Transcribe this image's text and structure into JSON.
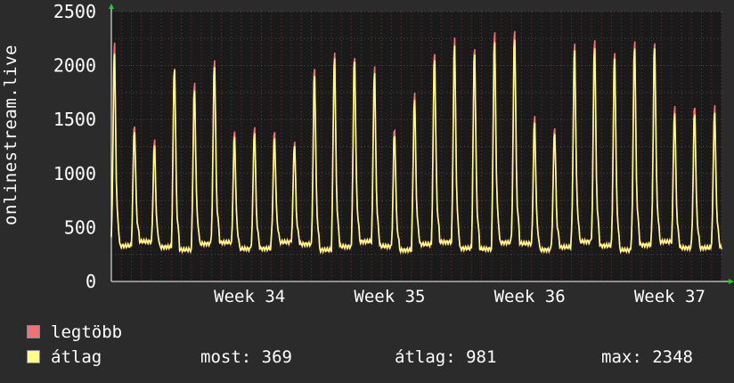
{
  "chart_data": {
    "type": "line",
    "ylabel": "onlinestream.live",
    "ylim": [
      0,
      2500
    ],
    "yticks": [
      0,
      500,
      1000,
      1500,
      2000,
      2500
    ],
    "xticks": [
      {
        "label": "Week 34",
        "day": 7
      },
      {
        "label": "Week 35",
        "day": 14
      },
      {
        "label": "Week 36",
        "day": 21
      },
      {
        "label": "Week 37",
        "day": 28
      }
    ],
    "x_range_days": [
      0,
      30.5
    ],
    "grid": true,
    "series": [
      {
        "name": "legtöbb",
        "color": "#f07178",
        "daily_peak": [
          2260,
          1500,
          1330,
          2060,
          1880,
          2130,
          1420,
          1480,
          1420,
          1330,
          2040,
          2180,
          2150,
          2040,
          1460,
          1780,
          2200,
          2310,
          2250,
          2360,
          2420,
          1560,
          1480,
          2260,
          2320,
          2180,
          2300,
          2280,
          1670
        ]
      },
      {
        "name": "átlag",
        "color": "#ffff80",
        "daily_peak": [
          2160,
          1440,
          1280,
          2040,
          1810,
          2060,
          1370,
          1420,
          1360,
          1290,
          1970,
          2130,
          2110,
          1980,
          1400,
          1720,
          2130,
          2240,
          2190,
          2270,
          2330,
          1500,
          1420,
          2200,
          2240,
          2130,
          2230,
          2230,
          1600
        ]
      }
    ]
  },
  "legend": {
    "max_label": "legtöbb",
    "avg_label": "átlag",
    "now_text": "most: 369",
    "avg_text": "átlag: 981",
    "maxval_text": "max: 2348"
  },
  "colors": {
    "max": "#f07178",
    "avg": "#ffff80",
    "bg": "#2b2b2b",
    "plot": "#1a1a1a",
    "grid": "#d04040"
  }
}
